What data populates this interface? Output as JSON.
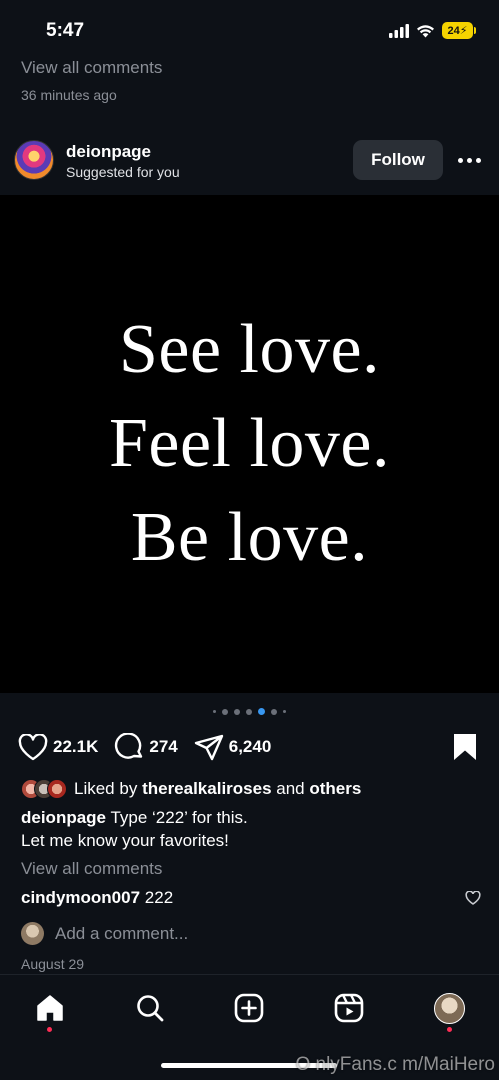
{
  "status": {
    "time": "5:47",
    "battery": "24"
  },
  "previous_post": {
    "view_comments": "View all comments",
    "time_ago": "36 minutes ago"
  },
  "post": {
    "username": "deionpage",
    "subtitle": "Suggested for you",
    "follow_label": "Follow",
    "quote_lines": [
      "See love.",
      "Feel love.",
      "Be love."
    ],
    "likes": "22.1K",
    "comments": "274",
    "shares": "6,240",
    "liked_by_prefix": "Liked by",
    "liked_by_user": "therealkaliroses",
    "liked_by_and": "and",
    "liked_by_others": "others",
    "caption_user": "deionpage",
    "caption_text": "Type ‘222’ for this.",
    "caption_line2": "Let me know your favorites!",
    "view_comments": "View all comments",
    "top_comment_user": "cindymoon007",
    "top_comment_text": "222",
    "add_comment_placeholder": "Add a comment...",
    "date": "August 29"
  },
  "carousel": {
    "active_index": 4,
    "count": 6
  },
  "watermark": "O nlyFans.c m/MaiHero",
  "colors": {
    "background": "#0d1117",
    "accent": "#3897f0",
    "notification": "#ff2d55"
  },
  "nav": [
    "home-icon",
    "search-icon",
    "create-icon",
    "reels-icon",
    "profile-avatar"
  ]
}
